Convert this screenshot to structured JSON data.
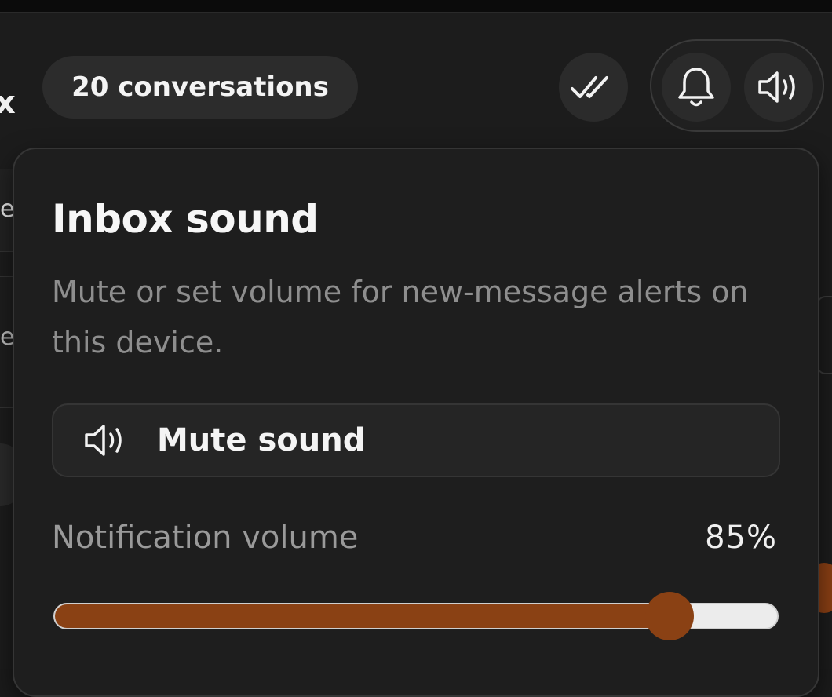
{
  "header": {
    "conversation_count": "20 conversations",
    "partial_title_glyph": "x"
  },
  "icons": {
    "mark_read": "double-check-icon",
    "notifications": "bell-icon",
    "sound": "speaker-icon"
  },
  "popover": {
    "title": "Inbox sound",
    "description": "Mute or set volume for new-message alerts on this device.",
    "mute_button_label": "Mute sound",
    "volume_label": "Notification volume",
    "volume_text": "85%",
    "volume_value": 0.85
  },
  "background": {
    "peek_letter_1": "e",
    "peek_letter_2": "e"
  },
  "colors": {
    "accent": "#8a4114",
    "surface": "#1e1e1e",
    "pill": "#2c2c2c"
  }
}
